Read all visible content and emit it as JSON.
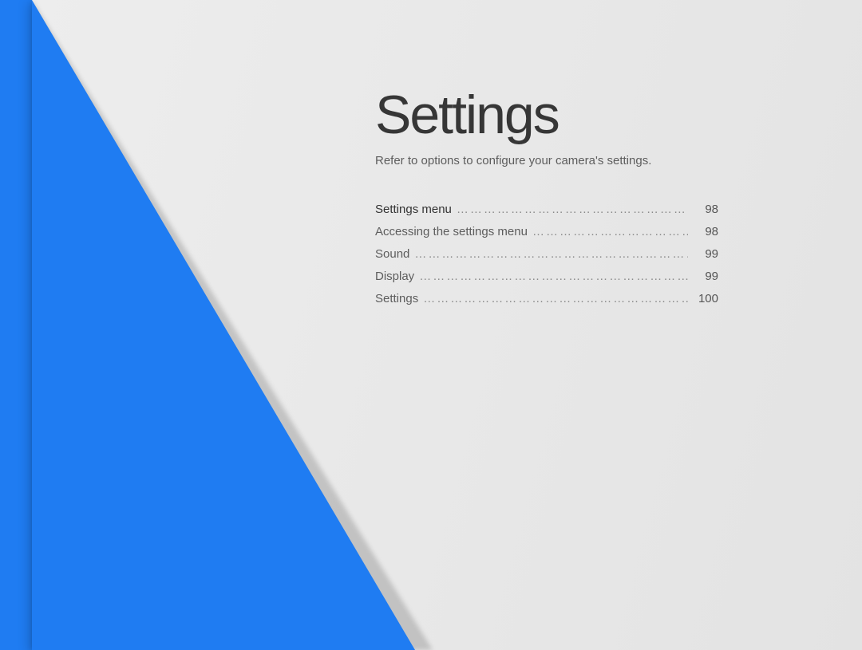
{
  "title": "Settings",
  "subtitle": "Refer to options to configure your camera's settings.",
  "toc": [
    {
      "label": "Settings menu",
      "page": "98",
      "header": true
    },
    {
      "label": "Accessing the settings menu",
      "page": "98",
      "header": false
    },
    {
      "label": "Sound",
      "page": "99",
      "header": false
    },
    {
      "label": "Display",
      "page": "99",
      "header": false
    },
    {
      "label": "Settings",
      "page": "100",
      "header": false
    }
  ],
  "colors": {
    "accent": "#1f7cf2",
    "page_bg": "#e8e8e8",
    "text": "#3a3a3a"
  }
}
